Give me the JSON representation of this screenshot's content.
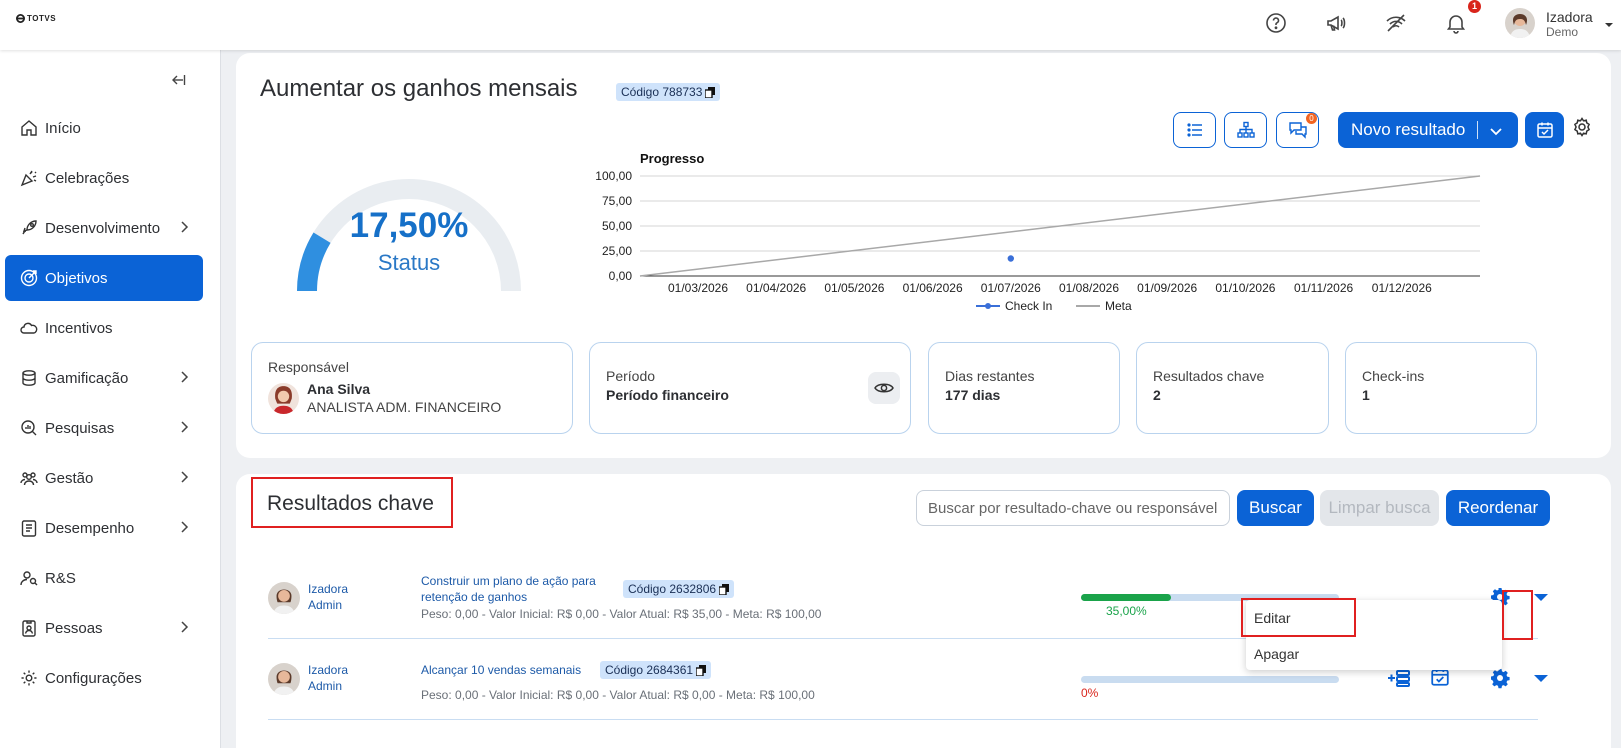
{
  "brand": {
    "logo_text": "TOTVS"
  },
  "header": {
    "icons": [
      "help-icon",
      "megaphone-icon",
      "signal-icon",
      "bell-icon"
    ],
    "notification_count": "1",
    "user": {
      "name": "Izadora",
      "role": "Demo"
    }
  },
  "sidebar": {
    "items": [
      {
        "label": "Início",
        "icon": "home-icon",
        "has_chevron": false
      },
      {
        "label": "Celebrações",
        "icon": "party-icon",
        "has_chevron": false
      },
      {
        "label": "Desenvolvimento",
        "icon": "rocket-icon",
        "has_chevron": true
      },
      {
        "label": "Objetivos",
        "icon": "target-icon",
        "has_chevron": false,
        "active": true
      },
      {
        "label": "Incentivos",
        "icon": "cloud-icon",
        "has_chevron": false
      },
      {
        "label": "Gamificação",
        "icon": "coins-icon",
        "has_chevron": true
      },
      {
        "label": "Pesquisas",
        "icon": "survey-icon",
        "has_chevron": true
      },
      {
        "label": "Gestão",
        "icon": "people-icon",
        "has_chevron": true
      },
      {
        "label": "Desempenho",
        "icon": "clipboard-icon",
        "has_chevron": true
      },
      {
        "label": "R&S",
        "icon": "recruit-icon",
        "has_chevron": false
      },
      {
        "label": "Pessoas",
        "icon": "badge-icon",
        "has_chevron": true
      },
      {
        "label": "Configurações",
        "icon": "gear-icon",
        "has_chevron": false
      }
    ]
  },
  "objective": {
    "title": "Aumentar os ganhos mensais",
    "code_label": "Código 788733",
    "chat_badge": "0",
    "new_result_label": "Novo resultado",
    "status_value": "17,50%",
    "status_label": "Status",
    "status_fraction": 0.175
  },
  "chart_data": {
    "type": "line",
    "title": "Progresso",
    "x": [
      "01/03/2026",
      "01/04/2026",
      "01/05/2026",
      "01/06/2026",
      "01/07/2026",
      "01/08/2026",
      "01/09/2026",
      "01/10/2026",
      "01/11/2026",
      "01/12/2026"
    ],
    "y_ticks": [
      "100,00",
      "75,00",
      "50,00",
      "25,00",
      "0,00"
    ],
    "ylim": [
      0,
      100
    ],
    "series": [
      {
        "name": "Check In",
        "color": "#3a6fd8",
        "points": [
          {
            "x": "01/07/2026",
            "y": 17.5
          }
        ]
      },
      {
        "name": "Meta",
        "color": "#a8a8a8",
        "points": [
          {
            "x": "start",
            "y": 0
          },
          {
            "x": "end",
            "y": 100
          }
        ]
      }
    ],
    "legend_position": "bottom"
  },
  "info": {
    "responsavel": {
      "label": "Responsável",
      "name": "Ana Silva",
      "role": "ANALISTA ADM. FINANCEIRO"
    },
    "periodo": {
      "label": "Período",
      "value": "Período financeiro"
    },
    "dias": {
      "label": "Dias restantes",
      "value": "177 dias"
    },
    "resultados": {
      "label": "Resultados chave",
      "value": "2"
    },
    "checkins": {
      "label": "Check-ins",
      "value": "1"
    }
  },
  "key_results": {
    "title": "Resultados chave",
    "search_placeholder": "Buscar por resultado-chave ou responsável",
    "search_button": "Buscar",
    "clear_button": "Limpar busca",
    "reorder_button": "Reordenar",
    "rows": [
      {
        "owner_first": "Izadora",
        "owner_last": "Admin",
        "name_line1": "Construir um plano de ação para",
        "name_line2": "retenção de ganhos",
        "code_label": "Código 2632806",
        "meta": "Peso: 0,00 -  Valor Inicial: R$ 0,00  -   Valor Atual: R$ 35,00  -   Meta: R$ 100,00",
        "progress_label": "35,00%",
        "progress": 0.35,
        "progress_color": "#1aa34a"
      },
      {
        "owner_first": "Izadora",
        "owner_last": "Admin",
        "name_line1": "Alcançar 10 vendas semanais",
        "code_label": "Código 2684361",
        "meta": "Peso: 0,00 -  Valor Inicial: R$ 0,00  -   Valor Atual: R$ 0,00  -   Meta: R$ 100,00",
        "progress_label": "0%",
        "progress": 0,
        "progress_color": "#d9251c"
      }
    ],
    "menu": {
      "edit": "Editar",
      "delete": "Apagar"
    }
  }
}
